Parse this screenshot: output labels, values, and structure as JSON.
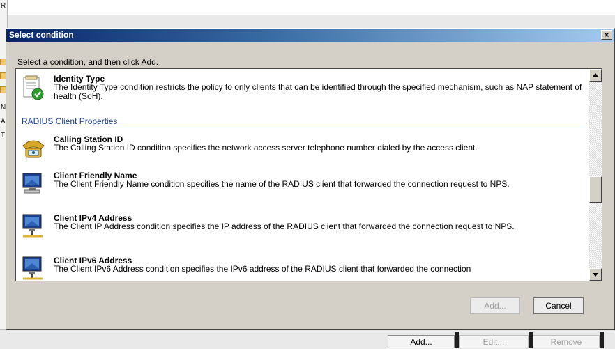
{
  "background": {
    "left_chars": [
      "R",
      "N",
      "A",
      "T"
    ],
    "buttons": {
      "add": "Add...",
      "edit": "Edit...",
      "remove": "Remove"
    }
  },
  "dialog": {
    "title": "Select condition",
    "instruction": "Select a condition, and then click Add.",
    "close_glyph": "×",
    "items_top": [
      {
        "title": "Identity Type",
        "description": "The Identity Type condition restricts the policy to only clients that can be identified through the specified mechanism, such as NAP statement of health (SoH).",
        "icon": "document-check-icon"
      }
    ],
    "group_header": "RADIUS Client Properties",
    "items": [
      {
        "title": "Calling Station ID",
        "description": "The Calling Station ID condition specifies the network access server telephone number dialed by the access client.",
        "icon": "telephone-icon"
      },
      {
        "title": "Client Friendly Name",
        "description": "The Client Friendly Name condition specifies the name of the RADIUS client that forwarded the connection request to NPS.",
        "icon": "computer-icon"
      },
      {
        "title": "Client IPv4 Address",
        "description": "The Client IP Address condition specifies the IP address of the RADIUS client that forwarded the connection request to NPS.",
        "icon": "network-computer-icon"
      },
      {
        "title": "Client IPv6 Address",
        "description": "The Client IPv6 Address condition specifies the IPv6 address of the RADIUS client that forwarded the connection",
        "icon": "network-computer-icon"
      }
    ],
    "buttons": {
      "add": "Add...",
      "cancel": "Cancel"
    }
  }
}
